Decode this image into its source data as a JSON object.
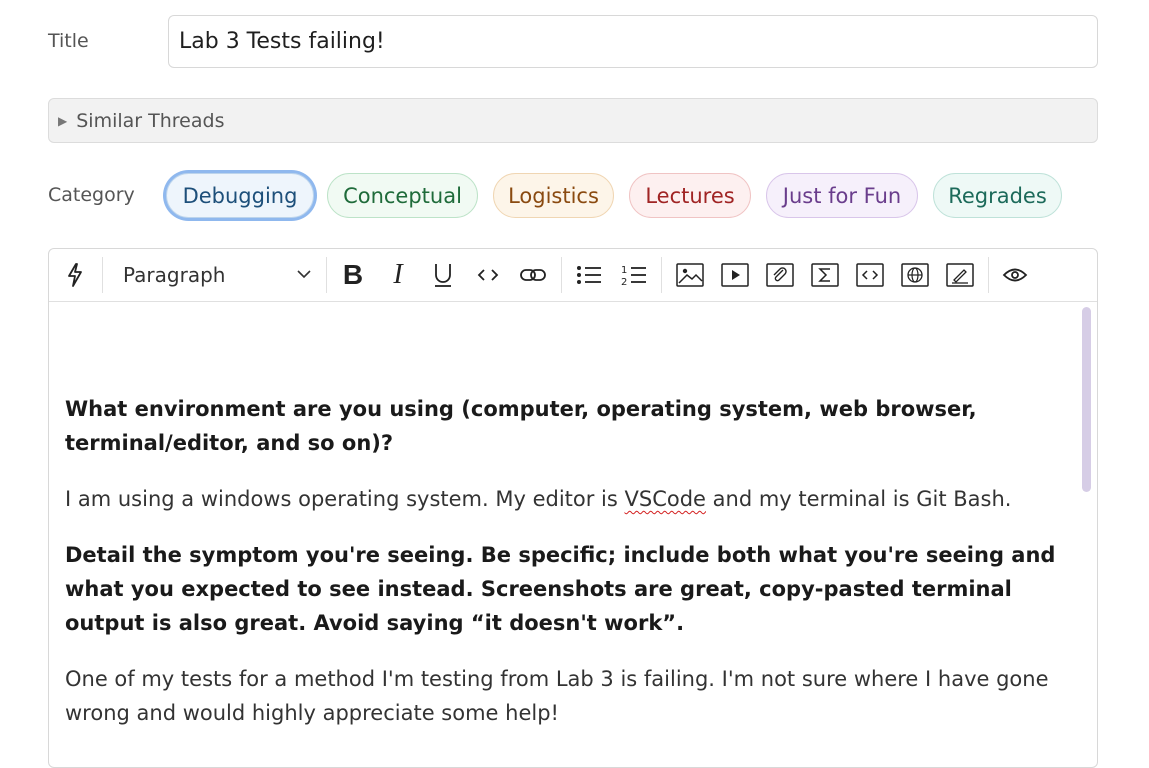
{
  "title": {
    "label": "Title",
    "value": "Lab 3 Tests failing!"
  },
  "similar_threads": {
    "label": "Similar Threads"
  },
  "category": {
    "label": "Category",
    "selected": "Debugging",
    "chips": [
      {
        "label": "Debugging",
        "text_color": "#1d4f7a",
        "bg": "#eef5fc",
        "border": "#bcd4ec"
      },
      {
        "label": "Conceptual",
        "text_color": "#1f6b3a",
        "bg": "#f1faf3",
        "border": "#bde3c8"
      },
      {
        "label": "Logistics",
        "text_color": "#8a4a10",
        "bg": "#fdf5e9",
        "border": "#f0d6b3"
      },
      {
        "label": "Lectures",
        "text_color": "#a02424",
        "bg": "#fdf0f0",
        "border": "#f0c4c4"
      },
      {
        "label": "Just for Fun",
        "text_color": "#6a3d8c",
        "bg": "#f6f0fb",
        "border": "#d9c6ea"
      },
      {
        "label": "Regrades",
        "text_color": "#1c6a5a",
        "bg": "#eef9f6",
        "border": "#bfe2d9"
      }
    ]
  },
  "toolbar": {
    "block_format": "Paragraph",
    "icons": [
      "lightning-icon",
      "bold-icon",
      "italic-icon",
      "underline-icon",
      "inline-code-icon",
      "link-icon",
      "bullet-list-icon",
      "numbered-list-icon",
      "image-icon",
      "video-icon",
      "attachment-icon",
      "math-icon",
      "code-block-icon",
      "web-snippet-icon",
      "drawing-icon",
      "preview-icon"
    ]
  },
  "content": {
    "q1": "What environment are you using (computer, operating system, web browser, terminal/editor, and so on)?",
    "a1_before": "I am using a windows operating system. My editor is ",
    "a1_spell": "VSCode",
    "a1_after": " and my terminal is Git Bash.",
    "q2": "Detail the symptom you're seeing. Be specific; include both what you're seeing and what you expected to see instead. Screenshots are great, copy-pasted terminal output is also great. Avoid saying “it doesn't work”.",
    "a2": "One of my tests for a method I'm testing from Lab 3 is failing. I'm not sure where I have gone wrong and would highly appreciate some help!"
  }
}
